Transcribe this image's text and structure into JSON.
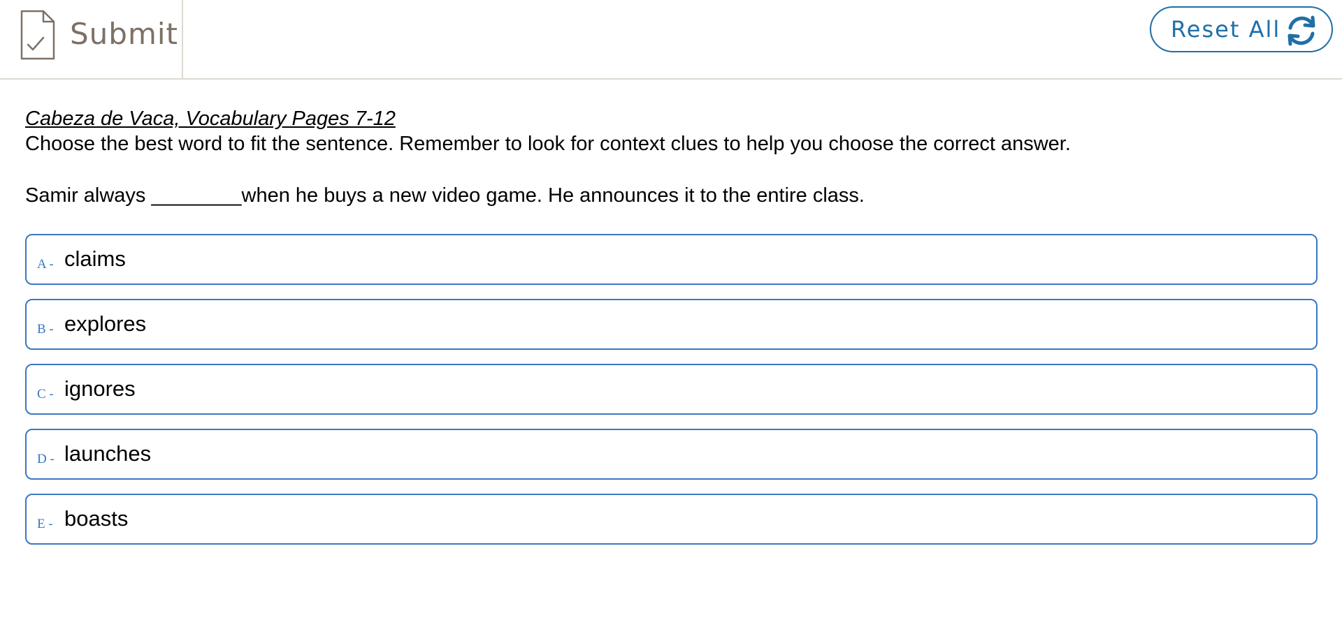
{
  "toolbar": {
    "submit_label": "Submit",
    "reset_label": "Reset All"
  },
  "question": {
    "title": "Cabeza de Vaca, Vocabulary Pages 7-12",
    "instructions": "Choose the best word to fit the sentence. Remember to look for context clues to help you choose the correct answer.",
    "prompt": "Samir always ________when he buys a new video game. He announces it to the entire class."
  },
  "options": [
    {
      "letter": "A -",
      "text": "claims"
    },
    {
      "letter": "B -",
      "text": "explores"
    },
    {
      "letter": "C -",
      "text": "ignores"
    },
    {
      "letter": "D -",
      "text": "launches"
    },
    {
      "letter": "E -",
      "text": "boasts"
    }
  ],
  "icons": {
    "submit": "document-check-icon",
    "reset": "refresh-icon"
  },
  "colors": {
    "accent": "#1f6fa8",
    "option_border": "#3a78c2",
    "submit_text": "#7d7065",
    "divider": "#ddd9d2"
  }
}
